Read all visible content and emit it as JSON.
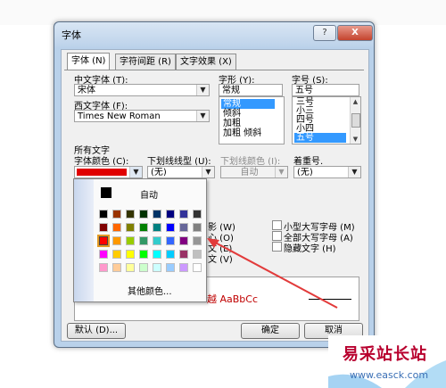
{
  "dialog": {
    "title": "字体",
    "help_label": "?",
    "close_label": "X"
  },
  "tabs": [
    {
      "label": "字体 (N)"
    },
    {
      "label": "字符间距 (R)"
    },
    {
      "label": "文字效果 (X)"
    }
  ],
  "font": {
    "cn_font_label": "中文字体 (T):",
    "cn_font_value": "宋体",
    "west_font_label": "西文字体 (F):",
    "west_font_value": "Times New Roman",
    "style_label": "字形 (Y):",
    "style_value": "常规",
    "style_options": [
      "常规",
      "倾斜",
      "加粗",
      "加粗 倾斜"
    ],
    "style_selected": "常规",
    "size_label": "字号 (S):",
    "size_value": "五号",
    "size_options": [
      "三号",
      "小三",
      "四号",
      "小四",
      "五号"
    ],
    "size_selected": "五号"
  },
  "all_text": {
    "section_label": "所有文字",
    "color_label": "字体颜色 (C):",
    "color_value": "#e00000",
    "underline_label": "下划线线型 (U):",
    "underline_value": "(无)",
    "underline_color_label": "下划线颜色 (I):",
    "underline_color_value": "自动",
    "emphasis_label": "着重号.",
    "emphasis_value": "(无)"
  },
  "effects": {
    "left_partial": [
      "影 (W)",
      "心 (O)",
      "文 (E)",
      "文 (V)"
    ],
    "right": [
      "小型大写字母 (M)",
      "全部大写字母 (A)",
      "隐藏文字 (H)"
    ]
  },
  "preview": {
    "sample_text": "越  AaBbCc"
  },
  "footer": {
    "default_label": "默认 (D)...",
    "ok_label": "确定",
    "cancel_label": "取消"
  },
  "color_picker": {
    "auto_label": "自动",
    "more_label": "其他颜色...",
    "rows": [
      [
        "#000000",
        "#993300",
        "#333300",
        "#003300",
        "#003366",
        "#000080",
        "#333399",
        "#333333"
      ],
      [
        "#800000",
        "#ff6600",
        "#808000",
        "#008000",
        "#008080",
        "#0000ff",
        "#666699",
        "#808080"
      ],
      [
        "#ff0000",
        "#ff9900",
        "#99cc00",
        "#339966",
        "#33cccc",
        "#3366ff",
        "#800080",
        "#969696"
      ],
      [
        "#ff00ff",
        "#ffcc00",
        "#ffff00",
        "#00ff00",
        "#00ffff",
        "#00ccff",
        "#993366",
        "#c0c0c0"
      ],
      [
        "#ff99cc",
        "#ffcc99",
        "#ffff99",
        "#ccffcc",
        "#ccffff",
        "#99ccff",
        "#cc99ff",
        "#ffffff"
      ]
    ],
    "selected": "#ff0000"
  },
  "watermark": {
    "brand": "易采站长站",
    "url": "www.easck.com"
  }
}
